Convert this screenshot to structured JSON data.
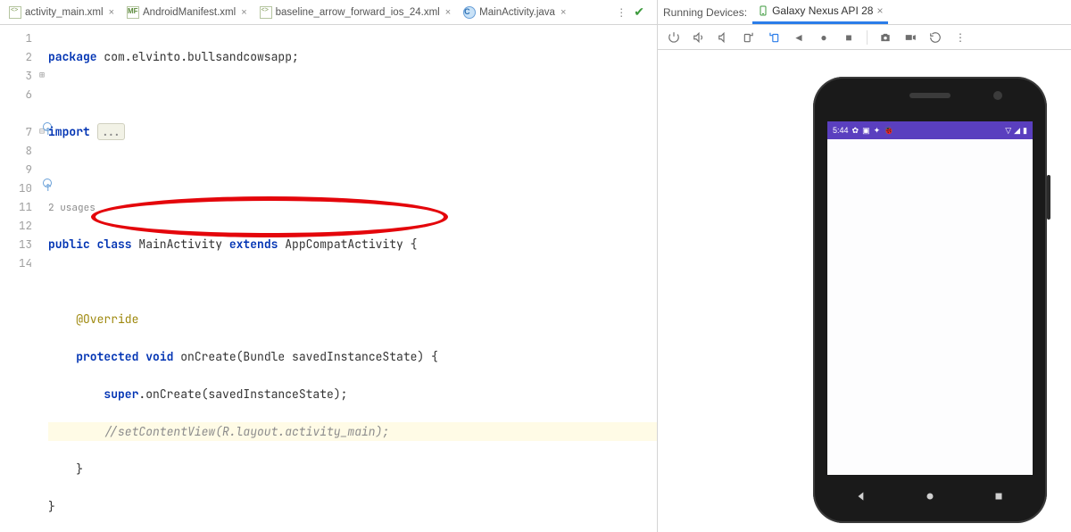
{
  "tabs": [
    {
      "label": "activity_main.xml",
      "iconClass": "ic-xml",
      "active": false
    },
    {
      "label": "AndroidManifest.xml",
      "iconClass": "ic-mf",
      "iconText": "MF",
      "active": false
    },
    {
      "label": "baseline_arrow_forward_ios_24.xml",
      "iconClass": "ic-xml",
      "active": false
    },
    {
      "label": "MainActivity.java",
      "iconClass": "ic-java",
      "iconText": "C",
      "active": true
    }
  ],
  "gutter": [
    "1",
    "2",
    "3",
    "6",
    "",
    "7",
    "8",
    "9",
    "10",
    "11",
    "12",
    "13",
    "14"
  ],
  "code": {
    "l1_kw": "package",
    "l1_pkg": " com.elvinto.bullsandcowsapp",
    "l3_kw": "import ",
    "l3_dots": "...",
    "usages": "2 usages",
    "l7a": "public class ",
    "l7b": "MainActivity ",
    "l7c": "extends ",
    "l7d": "AppCompatActivity {",
    "l9": "@Override",
    "l10a": "protected ",
    "l10b": "void ",
    "l10c": "onCreate(Bundle savedInstanceState) {",
    "l11a": "super",
    "l11b": ".onCreate(savedInstanceState);",
    "l12": "//setContentView(R.layout.activity_main);",
    "l13": "}",
    "l14": "}"
  },
  "devices": {
    "panel_title": "Running Devices:",
    "tab_label": "Galaxy Nexus API 28"
  },
  "statusbar": {
    "time": "5:44"
  },
  "colors": {
    "accent": "#2b7de9",
    "annotation": "#e4060b",
    "status": "#5a3fbf"
  }
}
